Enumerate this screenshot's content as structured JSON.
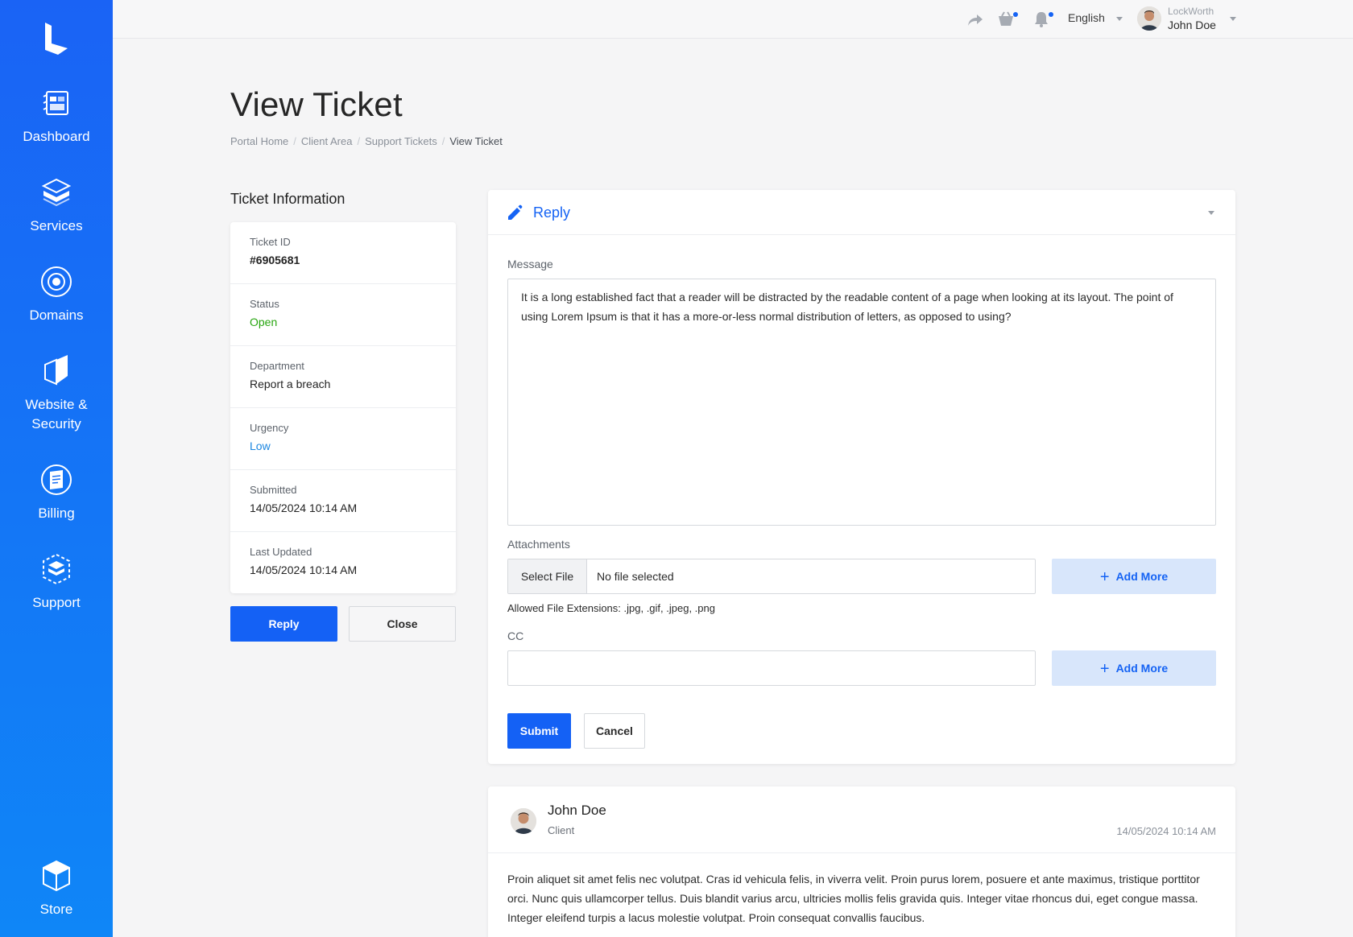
{
  "sidebar": {
    "items": [
      {
        "label": "Dashboard"
      },
      {
        "label": "Services"
      },
      {
        "label": "Domains"
      },
      {
        "label": "Website &\nSecurity"
      },
      {
        "label": "Billing"
      },
      {
        "label": "Support"
      },
      {
        "label": "Store"
      }
    ]
  },
  "topbar": {
    "language": "English",
    "org": "LockWorth",
    "user_name": "John Doe"
  },
  "header": {
    "title": "View Ticket",
    "breadcrumb": [
      "Portal Home",
      "Client Area",
      "Support Tickets",
      "View Ticket"
    ]
  },
  "ticket_info": {
    "title": "Ticket Information",
    "rows": [
      {
        "key": "Ticket ID",
        "value": "#6905681"
      },
      {
        "key": "Status",
        "value": "Open"
      },
      {
        "key": "Department",
        "value": "Report a breach"
      },
      {
        "key": "Urgency",
        "value": "Low"
      },
      {
        "key": "Submitted",
        "value": "14/05/2024 10:14 AM"
      },
      {
        "key": "Last Updated",
        "value": "14/05/2024 10:14 AM"
      }
    ],
    "reply_label": "Reply",
    "close_label": "Close"
  },
  "reply": {
    "title": "Reply",
    "message_label": "Message",
    "message": "It is a long established fact that a reader will be distracted by the readable content of a page when looking at its layout. The point of using Lorem Ipsum is that it has a more-or-less normal distribution of letters, as opposed to using?",
    "attachments_label": "Attachments",
    "select_file": "Select File",
    "no_file": "No file selected",
    "add_more": "Add More",
    "allowed": "Allowed File Extensions: .jpg, .gif, .jpeg, .png",
    "cc_label": "CC",
    "cc_value": "",
    "submit": "Submit",
    "cancel": "Cancel"
  },
  "message": {
    "author": "John Doe",
    "role": "Client",
    "date": "14/05/2024 10:14 AM",
    "body": "Proin aliquet sit amet felis nec volutpat. Cras id vehicula felis, in viverra velit. Proin purus lorem, posuere et ante maximus, tristique porttitor orci. Nunc quis ullamcorper tellus. Duis blandit varius arcu, ultricies mollis felis gravida quis. Integer vitae rhoncus dui, eget congue massa. Integer eleifend turpis a lacus molestie volutpat. Proin consequat convallis faucibus."
  },
  "colors": {
    "brand": "#1461f5",
    "status_open": "#27a50f",
    "urgency_low": "#1b86e0"
  }
}
